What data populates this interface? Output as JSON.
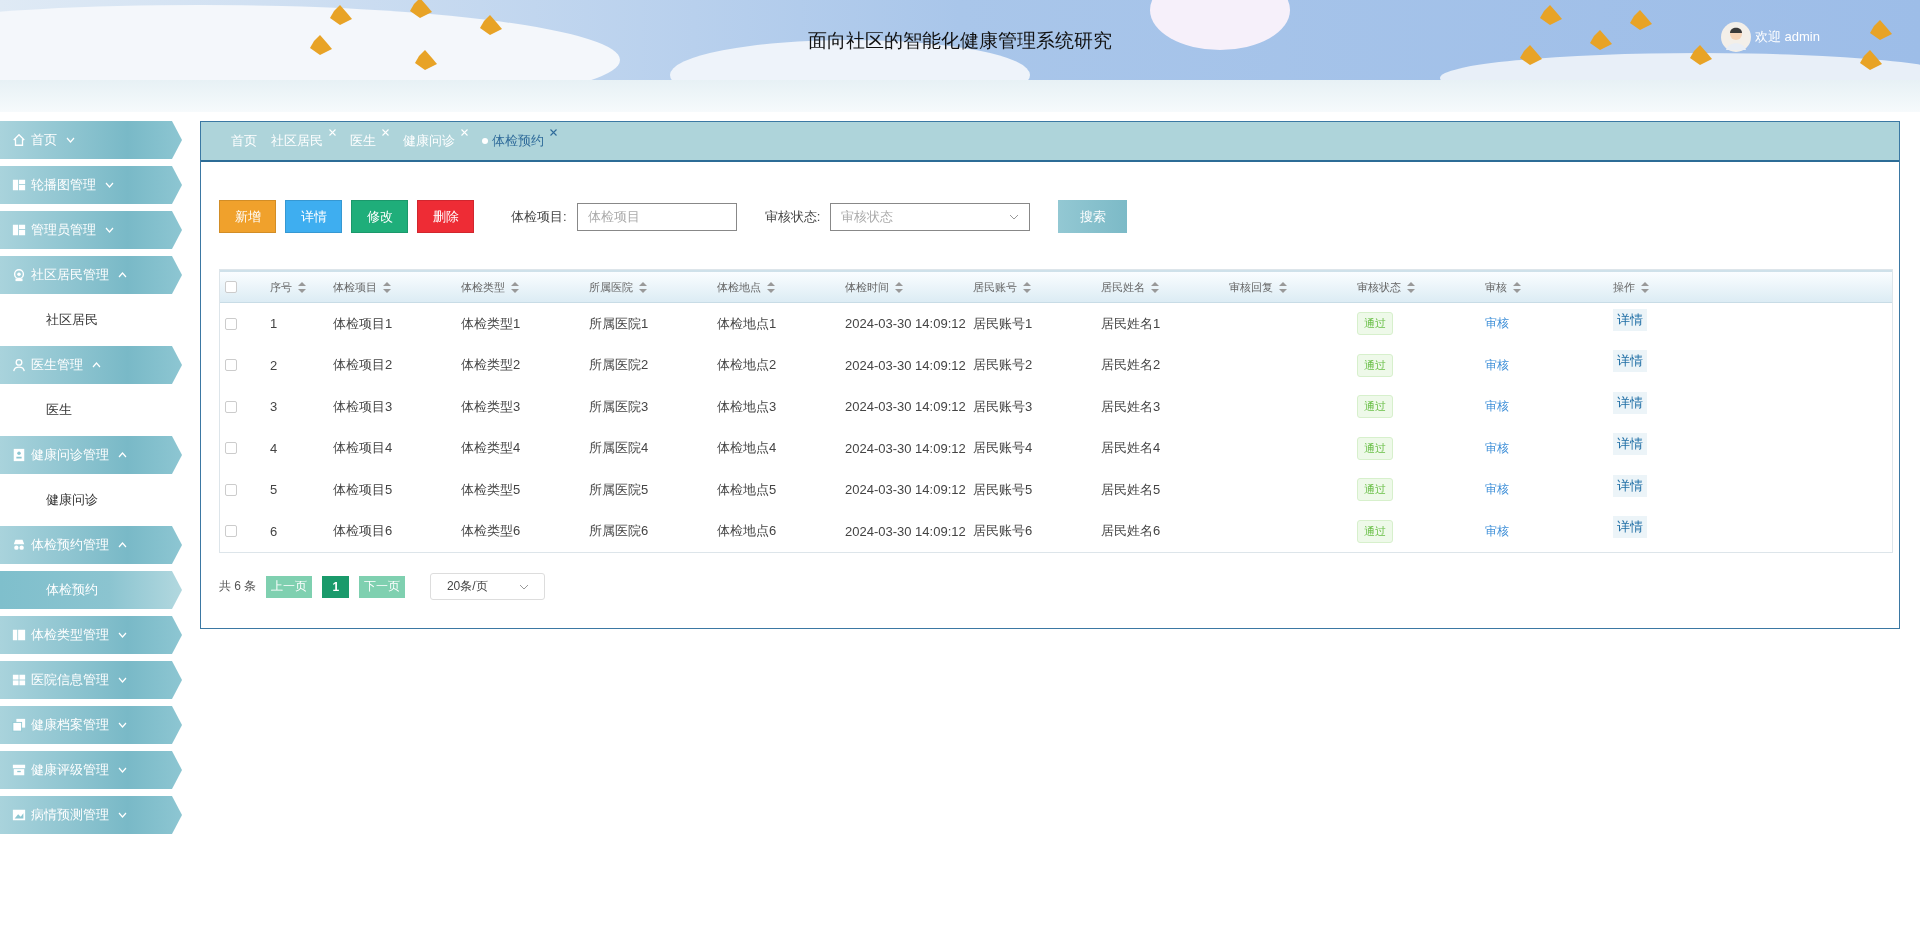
{
  "header": {
    "title": "面向社区的智能化健康管理系统研究",
    "welcome": "欢迎 admin"
  },
  "sidebar": {
    "items": [
      {
        "kind": "menu",
        "label": "首页",
        "expanded": false
      },
      {
        "kind": "menu",
        "label": "轮播图管理",
        "expanded": false
      },
      {
        "kind": "menu",
        "label": "管理员管理",
        "expanded": false
      },
      {
        "kind": "menu",
        "label": "社区居民管理",
        "expanded": true
      },
      {
        "kind": "submenu",
        "label": "社区居民",
        "selected": false
      },
      {
        "kind": "menu",
        "label": "医生管理",
        "expanded": true
      },
      {
        "kind": "submenu",
        "label": "医生",
        "selected": false
      },
      {
        "kind": "menu",
        "label": "健康问诊管理",
        "expanded": true
      },
      {
        "kind": "submenu",
        "label": "健康问诊",
        "selected": false
      },
      {
        "kind": "menu",
        "label": "体检预约管理",
        "expanded": true
      },
      {
        "kind": "submenu",
        "label": "体检预约",
        "selected": true
      },
      {
        "kind": "menu",
        "label": "体检类型管理",
        "expanded": false
      },
      {
        "kind": "menu",
        "label": "医院信息管理",
        "expanded": false
      },
      {
        "kind": "menu",
        "label": "健康档案管理",
        "expanded": false
      },
      {
        "kind": "menu",
        "label": "健康评级管理",
        "expanded": false
      },
      {
        "kind": "menu",
        "label": "病情预测管理",
        "expanded": false
      }
    ]
  },
  "tabs": [
    {
      "label": "首页",
      "closable": false,
      "selected": false
    },
    {
      "label": "社区居民",
      "closable": true,
      "selected": false
    },
    {
      "label": "医生",
      "closable": true,
      "selected": false
    },
    {
      "label": "健康问诊",
      "closable": true,
      "selected": false
    },
    {
      "label": "体检预约",
      "closable": true,
      "selected": true
    }
  ],
  "toolbar": {
    "buttons": [
      {
        "label": "新增",
        "color": "#f0a12c"
      },
      {
        "label": "详情",
        "color": "#3eaef0"
      },
      {
        "label": "修改",
        "color": "#1fae7a"
      },
      {
        "label": "删除",
        "color": "#ee2c35"
      }
    ],
    "filters": [
      {
        "kind": "input",
        "label": "体检项目:",
        "placeholder": "体检项目"
      },
      {
        "kind": "select",
        "label": "审核状态:",
        "placeholder": "审核状态"
      }
    ],
    "search": "搜索"
  },
  "table": {
    "columns": [
      "序号",
      "体检项目",
      "体检类型",
      "所属医院",
      "体检地点",
      "体检时间",
      "居民账号",
      "居民姓名",
      "审核回复",
      "审核状态",
      "审核",
      "操作"
    ],
    "all_checked": false,
    "rows": [
      {
        "checked": false,
        "cells": [
          "1",
          "体检项目1",
          "体检类型1",
          "所属医院1",
          "体检地点1",
          "2024-03-30 14:09:12",
          "居民账号1",
          "居民姓名1"
        ],
        "status": "通过",
        "review": "审核",
        "action": "详情"
      },
      {
        "checked": false,
        "cells": [
          "2",
          "体检项目2",
          "体检类型2",
          "所属医院2",
          "体检地点2",
          "2024-03-30 14:09:12",
          "居民账号2",
          "居民姓名2"
        ],
        "status": "通过",
        "review": "审核",
        "action": "详情"
      },
      {
        "checked": false,
        "cells": [
          "3",
          "体检项目3",
          "体检类型3",
          "所属医院3",
          "体检地点3",
          "2024-03-30 14:09:12",
          "居民账号3",
          "居民姓名3"
        ],
        "status": "通过",
        "review": "审核",
        "action": "详情"
      },
      {
        "checked": false,
        "cells": [
          "4",
          "体检项目4",
          "体检类型4",
          "所属医院4",
          "体检地点4",
          "2024-03-30 14:09:12",
          "居民账号4",
          "居民姓名4"
        ],
        "status": "通过",
        "review": "审核",
        "action": "详情"
      },
      {
        "checked": false,
        "cells": [
          "5",
          "体检项目5",
          "体检类型5",
          "所属医院5",
          "体检地点5",
          "2024-03-30 14:09:12",
          "居民账号5",
          "居民姓名5"
        ],
        "status": "通过",
        "review": "审核",
        "action": "详情"
      },
      {
        "checked": false,
        "cells": [
          "6",
          "体检项目6",
          "体检类型6",
          "所属医院6",
          "体检地点6",
          "2024-03-30 14:09:12",
          "居民账号6",
          "居民姓名6"
        ],
        "status": "通过",
        "review": "审核",
        "action": "详情"
      }
    ]
  },
  "pagination": {
    "total": "共 6 条",
    "prev": "上一页",
    "pages": [
      {
        "label": "1",
        "selected": true
      }
    ],
    "next": "下一页",
    "page_size": "20条/页"
  }
}
